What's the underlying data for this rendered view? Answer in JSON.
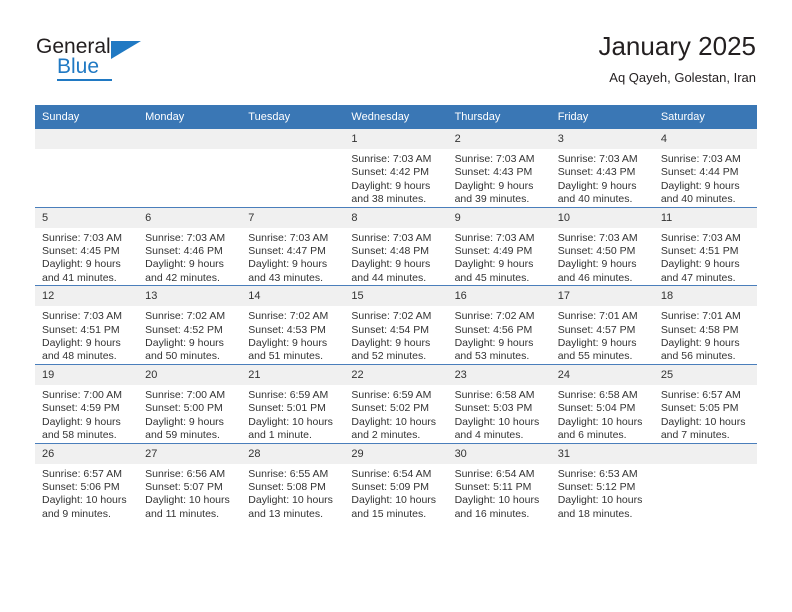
{
  "brand": {
    "name_top": "General",
    "name_bottom": "Blue",
    "accent_color": "#2079c3"
  },
  "header": {
    "title": "January 2025",
    "subtitle": "Aq Qayeh, Golestan, Iran"
  },
  "theme": {
    "header_row_bg": "#3a77b5",
    "daynum_bg": "#f0f0f0",
    "row_divider": "#4a7ebb",
    "text": "#333333"
  },
  "weekday_headers": [
    "Sunday",
    "Monday",
    "Tuesday",
    "Wednesday",
    "Thursday",
    "Friday",
    "Saturday"
  ],
  "weeks": [
    [
      {
        "day": "",
        "empty": true,
        "sunrise": "",
        "sunset": "",
        "daylight_line1": "",
        "daylight_line2": ""
      },
      {
        "day": "",
        "empty": true,
        "sunrise": "",
        "sunset": "",
        "daylight_line1": "",
        "daylight_line2": ""
      },
      {
        "day": "",
        "empty": true,
        "sunrise": "",
        "sunset": "",
        "daylight_line1": "",
        "daylight_line2": ""
      },
      {
        "day": "1",
        "sunrise": "Sunrise: 7:03 AM",
        "sunset": "Sunset: 4:42 PM",
        "daylight_line1": "Daylight: 9 hours",
        "daylight_line2": "and 38 minutes."
      },
      {
        "day": "2",
        "sunrise": "Sunrise: 7:03 AM",
        "sunset": "Sunset: 4:43 PM",
        "daylight_line1": "Daylight: 9 hours",
        "daylight_line2": "and 39 minutes."
      },
      {
        "day": "3",
        "sunrise": "Sunrise: 7:03 AM",
        "sunset": "Sunset: 4:43 PM",
        "daylight_line1": "Daylight: 9 hours",
        "daylight_line2": "and 40 minutes."
      },
      {
        "day": "4",
        "sunrise": "Sunrise: 7:03 AM",
        "sunset": "Sunset: 4:44 PM",
        "daylight_line1": "Daylight: 9 hours",
        "daylight_line2": "and 40 minutes."
      }
    ],
    [
      {
        "day": "5",
        "sunrise": "Sunrise: 7:03 AM",
        "sunset": "Sunset: 4:45 PM",
        "daylight_line1": "Daylight: 9 hours",
        "daylight_line2": "and 41 minutes."
      },
      {
        "day": "6",
        "sunrise": "Sunrise: 7:03 AM",
        "sunset": "Sunset: 4:46 PM",
        "daylight_line1": "Daylight: 9 hours",
        "daylight_line2": "and 42 minutes."
      },
      {
        "day": "7",
        "sunrise": "Sunrise: 7:03 AM",
        "sunset": "Sunset: 4:47 PM",
        "daylight_line1": "Daylight: 9 hours",
        "daylight_line2": "and 43 minutes."
      },
      {
        "day": "8",
        "sunrise": "Sunrise: 7:03 AM",
        "sunset": "Sunset: 4:48 PM",
        "daylight_line1": "Daylight: 9 hours",
        "daylight_line2": "and 44 minutes."
      },
      {
        "day": "9",
        "sunrise": "Sunrise: 7:03 AM",
        "sunset": "Sunset: 4:49 PM",
        "daylight_line1": "Daylight: 9 hours",
        "daylight_line2": "and 45 minutes."
      },
      {
        "day": "10",
        "sunrise": "Sunrise: 7:03 AM",
        "sunset": "Sunset: 4:50 PM",
        "daylight_line1": "Daylight: 9 hours",
        "daylight_line2": "and 46 minutes."
      },
      {
        "day": "11",
        "sunrise": "Sunrise: 7:03 AM",
        "sunset": "Sunset: 4:51 PM",
        "daylight_line1": "Daylight: 9 hours",
        "daylight_line2": "and 47 minutes."
      }
    ],
    [
      {
        "day": "12",
        "sunrise": "Sunrise: 7:03 AM",
        "sunset": "Sunset: 4:51 PM",
        "daylight_line1": "Daylight: 9 hours",
        "daylight_line2": "and 48 minutes."
      },
      {
        "day": "13",
        "sunrise": "Sunrise: 7:02 AM",
        "sunset": "Sunset: 4:52 PM",
        "daylight_line1": "Daylight: 9 hours",
        "daylight_line2": "and 50 minutes."
      },
      {
        "day": "14",
        "sunrise": "Sunrise: 7:02 AM",
        "sunset": "Sunset: 4:53 PM",
        "daylight_line1": "Daylight: 9 hours",
        "daylight_line2": "and 51 minutes."
      },
      {
        "day": "15",
        "sunrise": "Sunrise: 7:02 AM",
        "sunset": "Sunset: 4:54 PM",
        "daylight_line1": "Daylight: 9 hours",
        "daylight_line2": "and 52 minutes."
      },
      {
        "day": "16",
        "sunrise": "Sunrise: 7:02 AM",
        "sunset": "Sunset: 4:56 PM",
        "daylight_line1": "Daylight: 9 hours",
        "daylight_line2": "and 53 minutes."
      },
      {
        "day": "17",
        "sunrise": "Sunrise: 7:01 AM",
        "sunset": "Sunset: 4:57 PM",
        "daylight_line1": "Daylight: 9 hours",
        "daylight_line2": "and 55 minutes."
      },
      {
        "day": "18",
        "sunrise": "Sunrise: 7:01 AM",
        "sunset": "Sunset: 4:58 PM",
        "daylight_line1": "Daylight: 9 hours",
        "daylight_line2": "and 56 minutes."
      }
    ],
    [
      {
        "day": "19",
        "sunrise": "Sunrise: 7:00 AM",
        "sunset": "Sunset: 4:59 PM",
        "daylight_line1": "Daylight: 9 hours",
        "daylight_line2": "and 58 minutes."
      },
      {
        "day": "20",
        "sunrise": "Sunrise: 7:00 AM",
        "sunset": "Sunset: 5:00 PM",
        "daylight_line1": "Daylight: 9 hours",
        "daylight_line2": "and 59 minutes."
      },
      {
        "day": "21",
        "sunrise": "Sunrise: 6:59 AM",
        "sunset": "Sunset: 5:01 PM",
        "daylight_line1": "Daylight: 10 hours",
        "daylight_line2": "and 1 minute."
      },
      {
        "day": "22",
        "sunrise": "Sunrise: 6:59 AM",
        "sunset": "Sunset: 5:02 PM",
        "daylight_line1": "Daylight: 10 hours",
        "daylight_line2": "and 2 minutes."
      },
      {
        "day": "23",
        "sunrise": "Sunrise: 6:58 AM",
        "sunset": "Sunset: 5:03 PM",
        "daylight_line1": "Daylight: 10 hours",
        "daylight_line2": "and 4 minutes."
      },
      {
        "day": "24",
        "sunrise": "Sunrise: 6:58 AM",
        "sunset": "Sunset: 5:04 PM",
        "daylight_line1": "Daylight: 10 hours",
        "daylight_line2": "and 6 minutes."
      },
      {
        "day": "25",
        "sunrise": "Sunrise: 6:57 AM",
        "sunset": "Sunset: 5:05 PM",
        "daylight_line1": "Daylight: 10 hours",
        "daylight_line2": "and 7 minutes."
      }
    ],
    [
      {
        "day": "26",
        "sunrise": "Sunrise: 6:57 AM",
        "sunset": "Sunset: 5:06 PM",
        "daylight_line1": "Daylight: 10 hours",
        "daylight_line2": "and 9 minutes."
      },
      {
        "day": "27",
        "sunrise": "Sunrise: 6:56 AM",
        "sunset": "Sunset: 5:07 PM",
        "daylight_line1": "Daylight: 10 hours",
        "daylight_line2": "and 11 minutes."
      },
      {
        "day": "28",
        "sunrise": "Sunrise: 6:55 AM",
        "sunset": "Sunset: 5:08 PM",
        "daylight_line1": "Daylight: 10 hours",
        "daylight_line2": "and 13 minutes."
      },
      {
        "day": "29",
        "sunrise": "Sunrise: 6:54 AM",
        "sunset": "Sunset: 5:09 PM",
        "daylight_line1": "Daylight: 10 hours",
        "daylight_line2": "and 15 minutes."
      },
      {
        "day": "30",
        "sunrise": "Sunrise: 6:54 AM",
        "sunset": "Sunset: 5:11 PM",
        "daylight_line1": "Daylight: 10 hours",
        "daylight_line2": "and 16 minutes."
      },
      {
        "day": "31",
        "sunrise": "Sunrise: 6:53 AM",
        "sunset": "Sunset: 5:12 PM",
        "daylight_line1": "Daylight: 10 hours",
        "daylight_line2": "and 18 minutes."
      },
      {
        "day": "",
        "empty": true,
        "sunrise": "",
        "sunset": "",
        "daylight_line1": "",
        "daylight_line2": ""
      }
    ]
  ]
}
